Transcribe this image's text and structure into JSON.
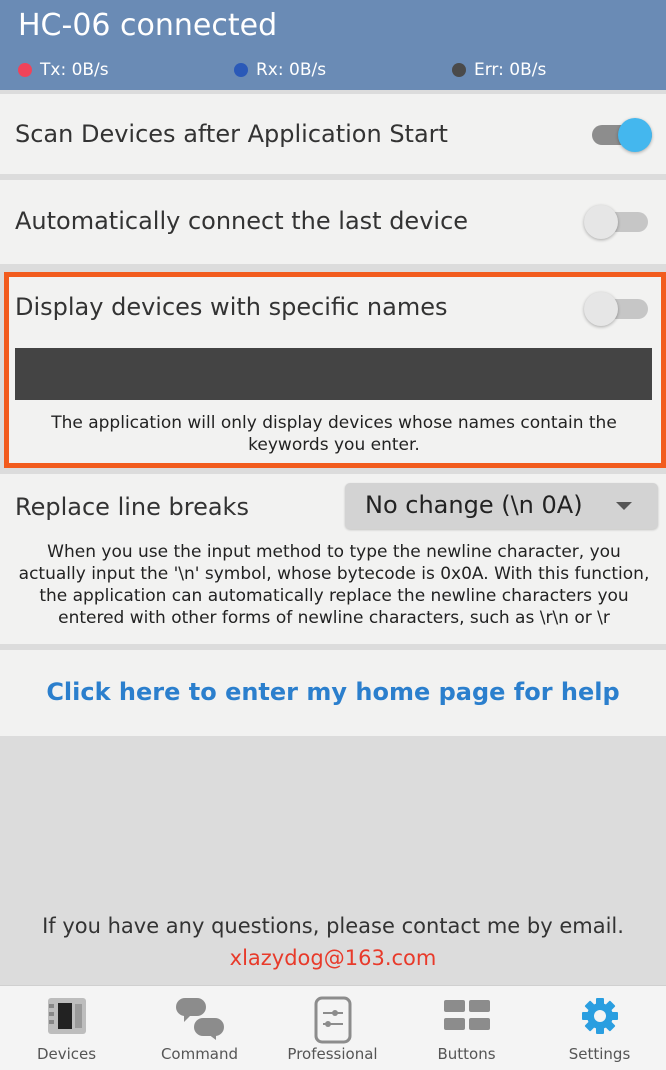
{
  "header": {
    "title": "HC-06 connected",
    "stats": [
      {
        "label": "Tx: 0B/s",
        "color": "#f0435a"
      },
      {
        "label": "Rx: 0B/s",
        "color": "#2a59b8"
      },
      {
        "label": "Err: 0B/s",
        "color": "#4a4a4a"
      }
    ]
  },
  "settings": {
    "scan_label": "Scan Devices after Application Start",
    "scan_on": true,
    "autoconnect_label": "Automatically connect the last device",
    "autoconnect_on": false,
    "filter_label": "Display devices with specific names",
    "filter_on": false,
    "filter_input_value": "",
    "filter_help": "The application will only display devices whose names contain the keywords you enter.",
    "linebreak_label": "Replace line breaks",
    "linebreak_selected": "No change (\\n 0A)",
    "linebreak_help": "When you use the input method to type the newline character, you actually input the '\\n' symbol, whose bytecode is 0x0A. With this function, the application can automatically replace the newline characters you entered with other forms of newline characters, such as \\r\\n or \\r",
    "help_link": "Click here to enter my home page for help"
  },
  "footer": {
    "contact_text": "If you have any questions, please contact me by email.",
    "email": "xlazydog@163.com"
  },
  "tabs": [
    {
      "label": "Devices",
      "icon": "devices-icon"
    },
    {
      "label": "Command",
      "icon": "command-icon"
    },
    {
      "label": "Professional",
      "icon": "professional-icon"
    },
    {
      "label": "Buttons",
      "icon": "buttons-icon"
    },
    {
      "label": "Settings",
      "icon": "settings-icon",
      "active": true
    }
  ],
  "colors": {
    "header_bg": "#6a8bb5",
    "accent": "#44b7ee",
    "highlight_border": "#f25c1e",
    "link": "#2b7fcd",
    "email": "#e83a2a"
  }
}
